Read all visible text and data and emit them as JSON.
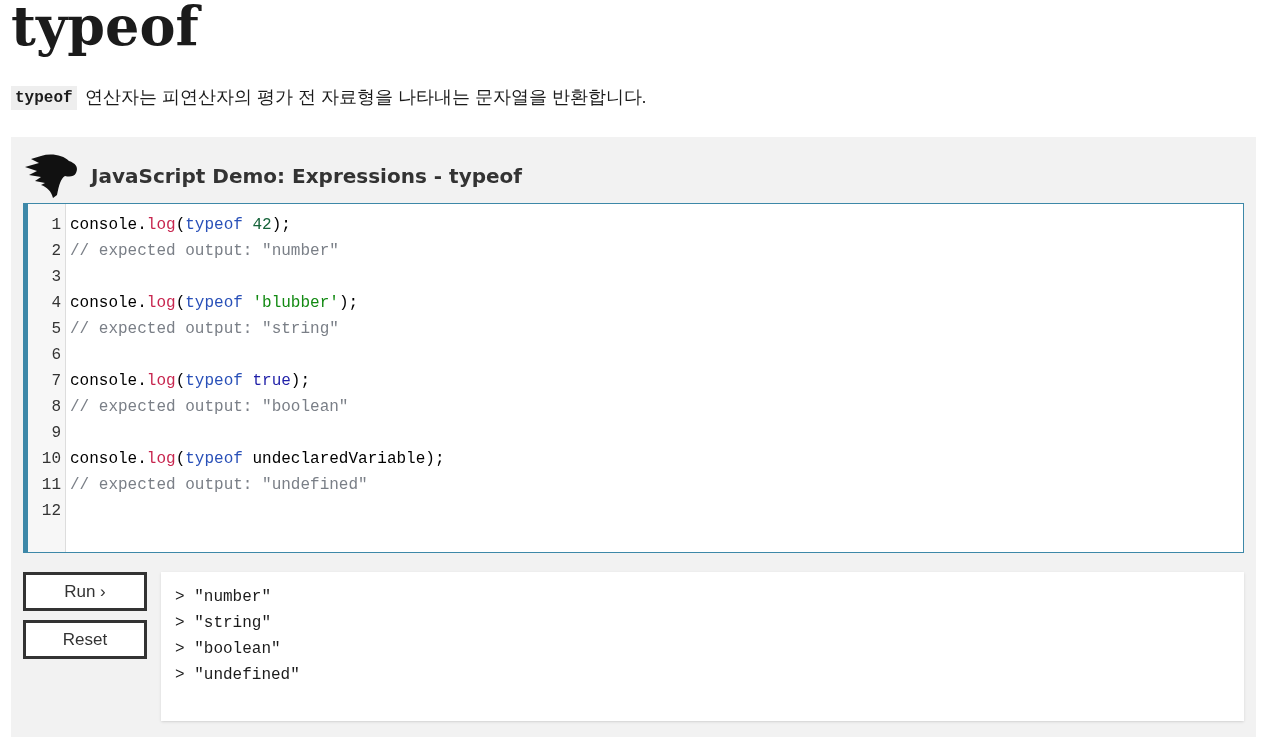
{
  "title": "typeof",
  "description": {
    "code": "typeof",
    "text": "연산자는 피연산자의 평가 전 자료형을 나타내는 문자열을 반환합니다."
  },
  "demo": {
    "title": "JavaScript Demo: Expressions - typeof",
    "editor": {
      "lines": [
        {
          "number": "1",
          "tokens": [
            {
              "kind": "plain",
              "text": "console."
            },
            {
              "kind": "property",
              "text": "log"
            },
            {
              "kind": "plain",
              "text": "("
            },
            {
              "kind": "keyword",
              "text": "typeof "
            },
            {
              "kind": "number",
              "text": "42"
            },
            {
              "kind": "plain",
              "text": ");"
            }
          ]
        },
        {
          "number": "2",
          "tokens": [
            {
              "kind": "comment",
              "text": "// expected output: \"number\""
            }
          ]
        },
        {
          "number": "3"
        },
        {
          "number": "4",
          "tokens": [
            {
              "kind": "plain",
              "text": "console."
            },
            {
              "kind": "property",
              "text": "log"
            },
            {
              "kind": "plain",
              "text": "("
            },
            {
              "kind": "keyword",
              "text": "typeof "
            },
            {
              "kind": "string",
              "text": "'blubber'"
            },
            {
              "kind": "plain",
              "text": ");"
            }
          ]
        },
        {
          "number": "5",
          "tokens": [
            {
              "kind": "comment",
              "text": "// expected output: \"string\""
            }
          ]
        },
        {
          "number": "6"
        },
        {
          "number": "7",
          "tokens": [
            {
              "kind": "plain",
              "text": "console."
            },
            {
              "kind": "property",
              "text": "log"
            },
            {
              "kind": "plain",
              "text": "("
            },
            {
              "kind": "keyword",
              "text": "typeof "
            },
            {
              "kind": "atom",
              "text": "true"
            },
            {
              "kind": "plain",
              "text": ");"
            }
          ]
        },
        {
          "number": "8",
          "tokens": [
            {
              "kind": "comment",
              "text": "// expected output: \"boolean\""
            }
          ]
        },
        {
          "number": "9"
        },
        {
          "number": "10",
          "tokens": [
            {
              "kind": "plain",
              "text": "console."
            },
            {
              "kind": "property",
              "text": "log"
            },
            {
              "kind": "plain",
              "text": "("
            },
            {
              "kind": "keyword",
              "text": "typeof "
            },
            {
              "kind": "plain",
              "text": "undeclaredVariable);"
            }
          ]
        },
        {
          "number": "11",
          "tokens": [
            {
              "kind": "comment",
              "text": "// expected output: \"undefined\""
            }
          ]
        },
        {
          "number": "12"
        }
      ]
    },
    "buttons": [
      "Run ›",
      "Reset"
    ],
    "output": [
      "> \"number\"",
      "> \"string\"",
      "> \"boolean\"",
      "> \"undefined\""
    ]
  }
}
